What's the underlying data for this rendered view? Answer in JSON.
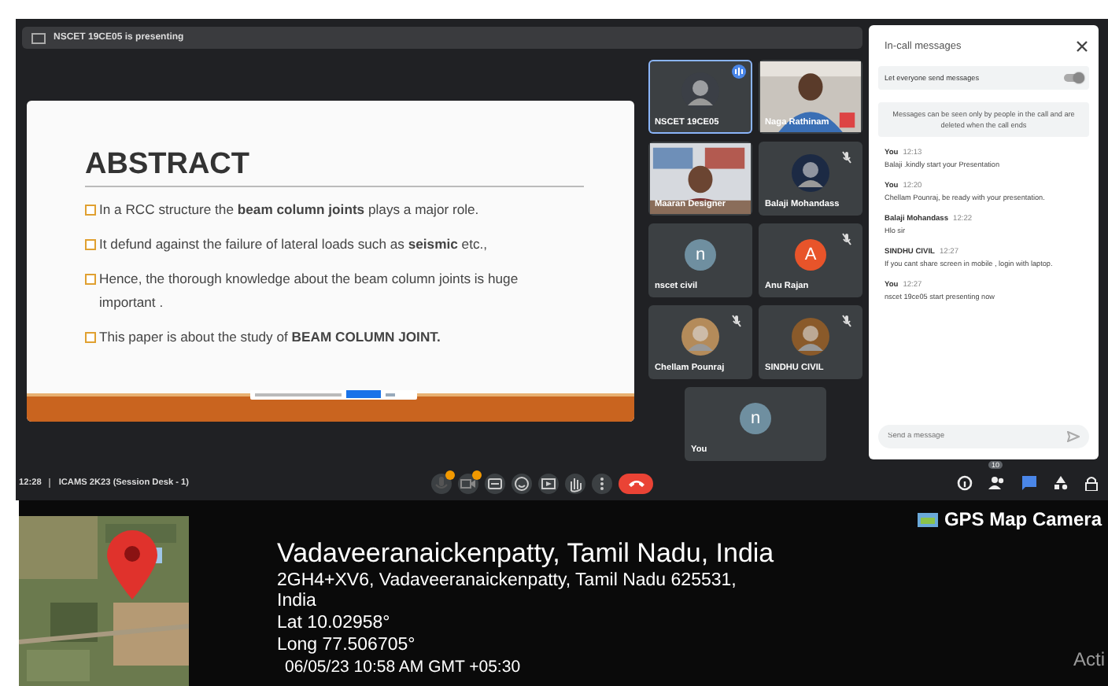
{
  "presenting_banner": "NSCET 19CE05 is presenting",
  "slide": {
    "title": "ABSTRACT",
    "bullets": [
      "In a RCC structure the **beam column joints** plays a major role.",
      "It defund against the failure of lateral loads such as **seismic** etc.,",
      "Hence, the thorough knowledge about the beam column joints is huge important .",
      "This paper is about the study of **BEAM COLUMN JOINT.**"
    ]
  },
  "participants": [
    {
      "name": "NSCET 19CE05",
      "kind": "avatar",
      "muted": false,
      "speaking": true
    },
    {
      "name": "Naga Rathinam",
      "kind": "video",
      "muted": false,
      "speaking": false
    },
    {
      "name": "Maaran Designer",
      "kind": "video",
      "muted": false,
      "speaking": false
    },
    {
      "name": "Balaji Mohandass",
      "kind": "avatar",
      "muted": true,
      "speaking": false
    },
    {
      "name": "nscet civil",
      "kind": "letter",
      "letter": "n",
      "color": "#6f8fa0",
      "muted": false,
      "speaking": false
    },
    {
      "name": "Anu Rajan",
      "kind": "letter",
      "letter": "A",
      "color": "#e8542a",
      "muted": true,
      "speaking": false
    },
    {
      "name": "Chellam Pounraj",
      "kind": "avatar",
      "muted": true,
      "speaking": false
    },
    {
      "name": "SINDHU CIVIL",
      "kind": "avatar",
      "muted": true,
      "speaking": false
    },
    {
      "name": "You",
      "kind": "letter",
      "letter": "n",
      "color": "#6f8fa0",
      "muted": false,
      "speaking": false
    }
  ],
  "chat": {
    "title": "In-call messages",
    "toggle": {
      "label": "Let everyone send messages",
      "on": true
    },
    "notice": "Messages can be seen only by people in the call and are deleted when the call ends",
    "messages": [
      {
        "sender": "You",
        "time": "12:13",
        "text": "Balaji .kindly start your Presentation"
      },
      {
        "sender": "You",
        "time": "12:20",
        "text": "Chellam Pounraj, be ready with your presentation."
      },
      {
        "sender": "Balaji Mohandass",
        "time": "12:22",
        "text": "Hlo sir"
      },
      {
        "sender": "SINDHU CIVIL",
        "time": "12:27",
        "text": "If you cant share screen in mobile , login with laptop."
      },
      {
        "sender": "You",
        "time": "12:27",
        "text": "nscet 19ce05 start presenting now"
      }
    ],
    "placeholder": "Send a message"
  },
  "bottom_bar": {
    "time": "12:28",
    "meeting": "ICAMS 2K23 (Session Desk - 1)",
    "participant_count": "10"
  },
  "gps": {
    "app": "GPS Map Camera",
    "place": "Vadaveeranaickenpatty, Tamil Nadu, India",
    "address": "2GH4+XV6, Vadaveeranaickenpatty, Tamil Nadu 625531, India",
    "lat": "Lat 10.02958°",
    "long": "Long 77.506705°",
    "datetime": "06/05/23 10:58 AM GMT +05:30"
  },
  "os_notice": "Acti"
}
